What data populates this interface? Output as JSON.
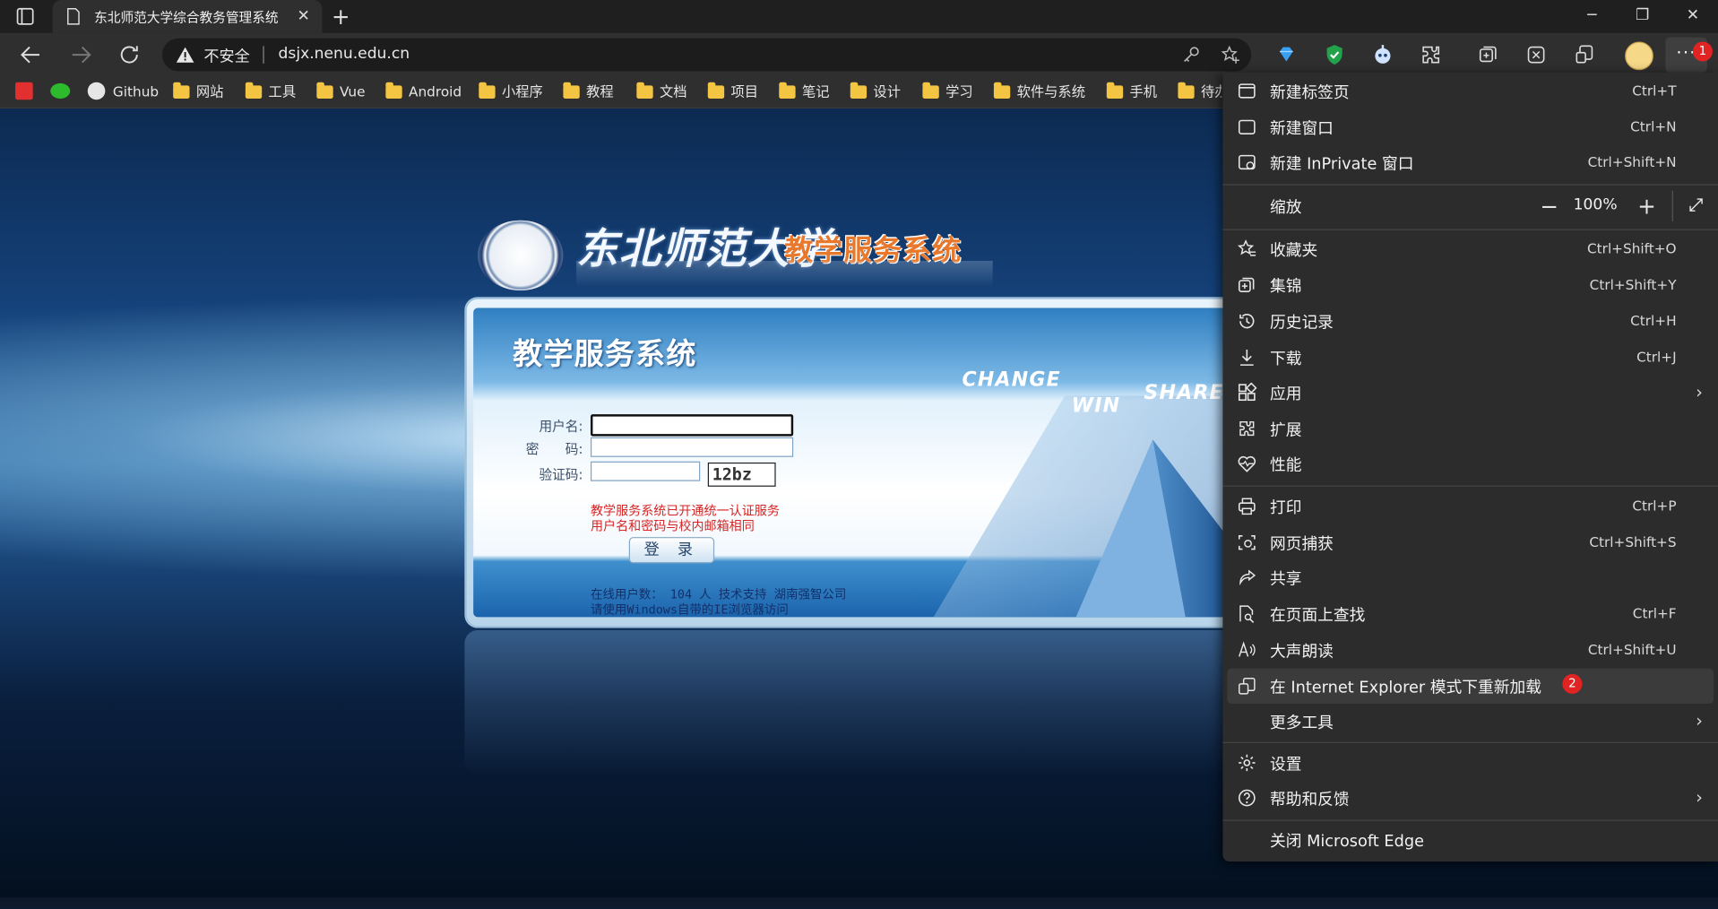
{
  "browser": {
    "tab": {
      "title": "东北师范大学综合教务管理系统",
      "close": "✕"
    },
    "new_tab": "+",
    "window": {
      "minimize": "─",
      "maximize": "❐",
      "close": "✕"
    },
    "address": {
      "security": "不安全",
      "url": "dsjx.nenu.edu.cn"
    },
    "more_button": "···",
    "badges": {
      "menu": "1",
      "ie_mode": "2"
    }
  },
  "bookmarks": [
    {
      "label": "Github",
      "type": "github"
    },
    {
      "label": "网站",
      "type": "folder"
    },
    {
      "label": "工具",
      "type": "folder"
    },
    {
      "label": "Vue",
      "type": "folder"
    },
    {
      "label": "Android",
      "type": "folder"
    },
    {
      "label": "小程序",
      "type": "folder"
    },
    {
      "label": "教程",
      "type": "folder"
    },
    {
      "label": "文档",
      "type": "folder"
    },
    {
      "label": "项目",
      "type": "folder"
    },
    {
      "label": "笔记",
      "type": "folder"
    },
    {
      "label": "设计",
      "type": "folder"
    },
    {
      "label": "学习",
      "type": "folder"
    },
    {
      "label": "软件与系统",
      "type": "folder"
    },
    {
      "label": "手机",
      "type": "folder"
    },
    {
      "label": "待办",
      "type": "folder"
    }
  ],
  "page": {
    "header": {
      "university": "东北师范大学",
      "system": "教学服务系统"
    },
    "panel_title": "教学服务系统",
    "slogans": {
      "change": "CHANGE",
      "win": "WIN",
      "share": "SHARE"
    },
    "form": {
      "username_label": "用户名:",
      "password_label": "密　　码:",
      "captcha_label": "验证码:",
      "captcha_value": "12bz"
    },
    "notice": [
      "教学服务系统已开通统一认证服务",
      "用户名和密码与校内邮箱相同"
    ],
    "login_button": "登 录",
    "footer": [
      "在线用户数： 104 人    技术支持 湖南强智公司",
      "请使用Windows自带的IE浏览器访问"
    ]
  },
  "menu": {
    "items": [
      {
        "label": "新建标签页",
        "shortcut": "Ctrl+T",
        "icon": "new-tab-icon"
      },
      {
        "label": "新建窗口",
        "shortcut": "Ctrl+N",
        "icon": "new-window-icon"
      },
      {
        "label": "新建 InPrivate 窗口",
        "shortcut": "Ctrl+Shift+N",
        "icon": "inprivate-icon"
      },
      {
        "label": "缩放",
        "icon": "zoom"
      },
      {
        "label": "收藏夹",
        "shortcut": "Ctrl+Shift+O",
        "icon": "favorites-icon"
      },
      {
        "label": "集锦",
        "shortcut": "Ctrl+Shift+Y",
        "icon": "collections-icon"
      },
      {
        "label": "历史记录",
        "shortcut": "Ctrl+H",
        "icon": "history-icon"
      },
      {
        "label": "下载",
        "shortcut": "Ctrl+J",
        "icon": "download-icon"
      },
      {
        "label": "应用",
        "icon": "apps-icon"
      },
      {
        "label": "扩展",
        "icon": "extensions-icon"
      },
      {
        "label": "性能",
        "icon": "performance-icon"
      },
      {
        "label": "打印",
        "shortcut": "Ctrl+P",
        "icon": "print-icon"
      },
      {
        "label": "网页捕获",
        "shortcut": "Ctrl+Shift+S",
        "icon": "capture-icon"
      },
      {
        "label": "共享",
        "icon": "share-icon"
      },
      {
        "label": "在页面上查找",
        "shortcut": "Ctrl+F",
        "icon": "find-icon"
      },
      {
        "label": "大声朗读",
        "shortcut": "Ctrl+Shift+U",
        "icon": "read-aloud-icon"
      },
      {
        "label": "在 Internet Explorer 模式下重新加载",
        "icon": "ie-mode-icon"
      },
      {
        "label": "更多工具",
        "icon": "more-tools"
      },
      {
        "label": "设置",
        "icon": "settings-icon"
      },
      {
        "label": "帮助和反馈",
        "icon": "help-icon"
      },
      {
        "label": "关闭 Microsoft Edge",
        "icon": "close-edge"
      }
    ],
    "zoom": {
      "value": "100%",
      "minus": "−",
      "plus": "+"
    },
    "submenu_arrow": "›"
  },
  "colors": {
    "badge": "#e02424",
    "notice_red": "#d82424",
    "menu_bg": "#2c2c2c"
  }
}
